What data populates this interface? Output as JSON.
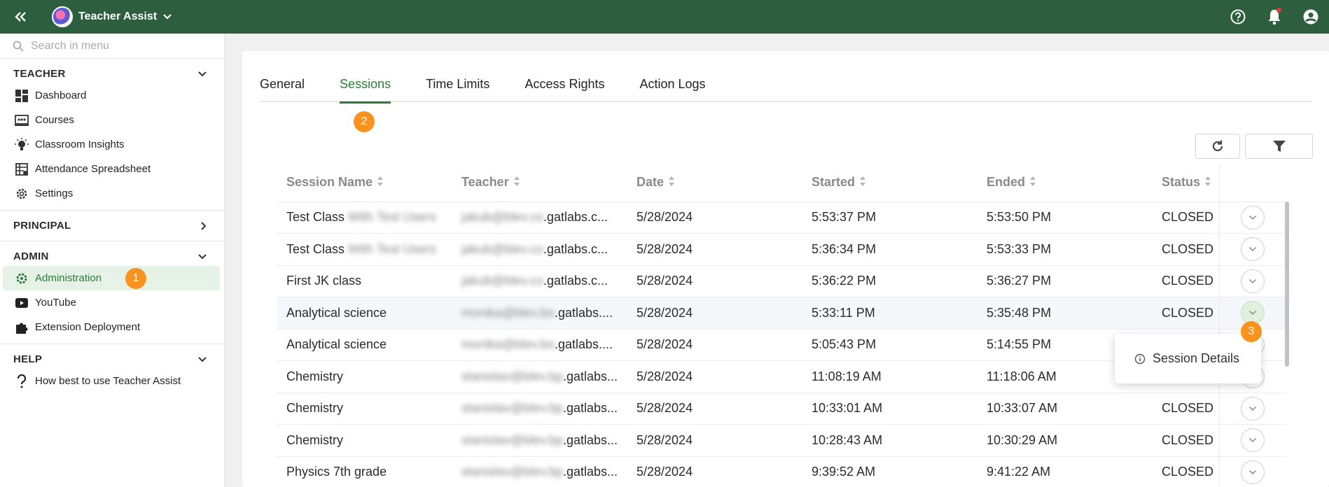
{
  "topbar": {
    "app_name": "Teacher Assist"
  },
  "sidebar": {
    "search_placeholder": "Search in menu",
    "sections": [
      {
        "title": "TEACHER",
        "items": [
          {
            "label": "Dashboard",
            "icon": "dashboard-icon"
          },
          {
            "label": "Courses",
            "icon": "courses-icon"
          },
          {
            "label": "Classroom Insights",
            "icon": "lightbulb-icon"
          },
          {
            "label": "Attendance Spreadsheet",
            "icon": "spreadsheet-icon"
          },
          {
            "label": "Settings",
            "icon": "gear-icon"
          }
        ]
      },
      {
        "title": "PRINCIPAL",
        "items": []
      },
      {
        "title": "ADMIN",
        "items": [
          {
            "label": "Administration",
            "icon": "gear-icon",
            "badge": "1"
          },
          {
            "label": "YouTube",
            "icon": "youtube-icon"
          },
          {
            "label": "Extension Deployment",
            "icon": "puzzle-icon"
          }
        ]
      },
      {
        "title": "HELP",
        "items": [
          {
            "label": "How best to use Teacher Assist",
            "icon": "question-icon"
          }
        ]
      }
    ]
  },
  "tabs": [
    {
      "label": "General"
    },
    {
      "label": "Sessions",
      "badge": "2"
    },
    {
      "label": "Time Limits"
    },
    {
      "label": "Access Rights"
    },
    {
      "label": "Action Logs"
    }
  ],
  "table": {
    "headers": [
      "Session Name",
      "Teacher",
      "Date",
      "Started",
      "Ended",
      "Status"
    ],
    "rows": [
      {
        "name": "Test Class ",
        "name_blur": "With Test Users",
        "teacher_blur": "jakub@blev.co",
        "teacher": ".gatlabs.c...",
        "date": "5/28/2024",
        "started": "5:53:37 PM",
        "ended": "5:53:50 PM",
        "status": "CLOSED"
      },
      {
        "name": "Test Class ",
        "name_blur": "With Test Users",
        "teacher_blur": "jakub@blev.co",
        "teacher": ".gatlabs.c...",
        "date": "5/28/2024",
        "started": "5:36:34 PM",
        "ended": "5:53:33 PM",
        "status": "CLOSED"
      },
      {
        "name": "First JK class",
        "name_blur": "",
        "teacher_blur": "jakub@blev.co",
        "teacher": ".gatlabs.c...",
        "date": "5/28/2024",
        "started": "5:36:22 PM",
        "ended": "5:36:27 PM",
        "status": "CLOSED"
      },
      {
        "name": "Analytical science",
        "name_blur": "",
        "teacher_blur": "monika@blev.bo",
        "teacher": ".gatlabs....",
        "date": "5/28/2024",
        "started": "5:33:11 PM",
        "ended": "5:35:48 PM",
        "status": "CLOSED"
      },
      {
        "name": "Analytical science",
        "name_blur": "",
        "teacher_blur": "monika@blev.bo",
        "teacher": ".gatlabs....",
        "date": "5/28/2024",
        "started": "5:05:43 PM",
        "ended": "5:14:55 PM",
        "status": ""
      },
      {
        "name": "Chemistry",
        "name_blur": "",
        "teacher_blur": "stanislav@blev.bp",
        "teacher": ".gatlabs...",
        "date": "5/28/2024",
        "started": "11:08:19 AM",
        "ended": "11:18:06 AM",
        "status": ""
      },
      {
        "name": "Chemistry",
        "name_blur": "",
        "teacher_blur": "stanislav@blev.bp",
        "teacher": ".gatlabs...",
        "date": "5/28/2024",
        "started": "10:33:01 AM",
        "ended": "10:33:07 AM",
        "status": "CLOSED"
      },
      {
        "name": "Chemistry",
        "name_blur": "",
        "teacher_blur": "stanislav@blev.bp",
        "teacher": ".gatlabs...",
        "date": "5/28/2024",
        "started": "10:28:43 AM",
        "ended": "10:30:29 AM",
        "status": "CLOSED"
      },
      {
        "name": "Physics 7th grade",
        "name_blur": "",
        "teacher_blur": "stanislav@blev.bp",
        "teacher": ".gatlabs...",
        "date": "5/28/2024",
        "started": "9:39:52 AM",
        "ended": "9:41:22 AM",
        "status": "CLOSED"
      }
    ]
  },
  "dropdown": {
    "item": "Session Details",
    "badge": "3"
  },
  "colors": {
    "topbar": "#2d5f3f",
    "accent": "#2d7a3a",
    "badge": "#f7931e"
  }
}
